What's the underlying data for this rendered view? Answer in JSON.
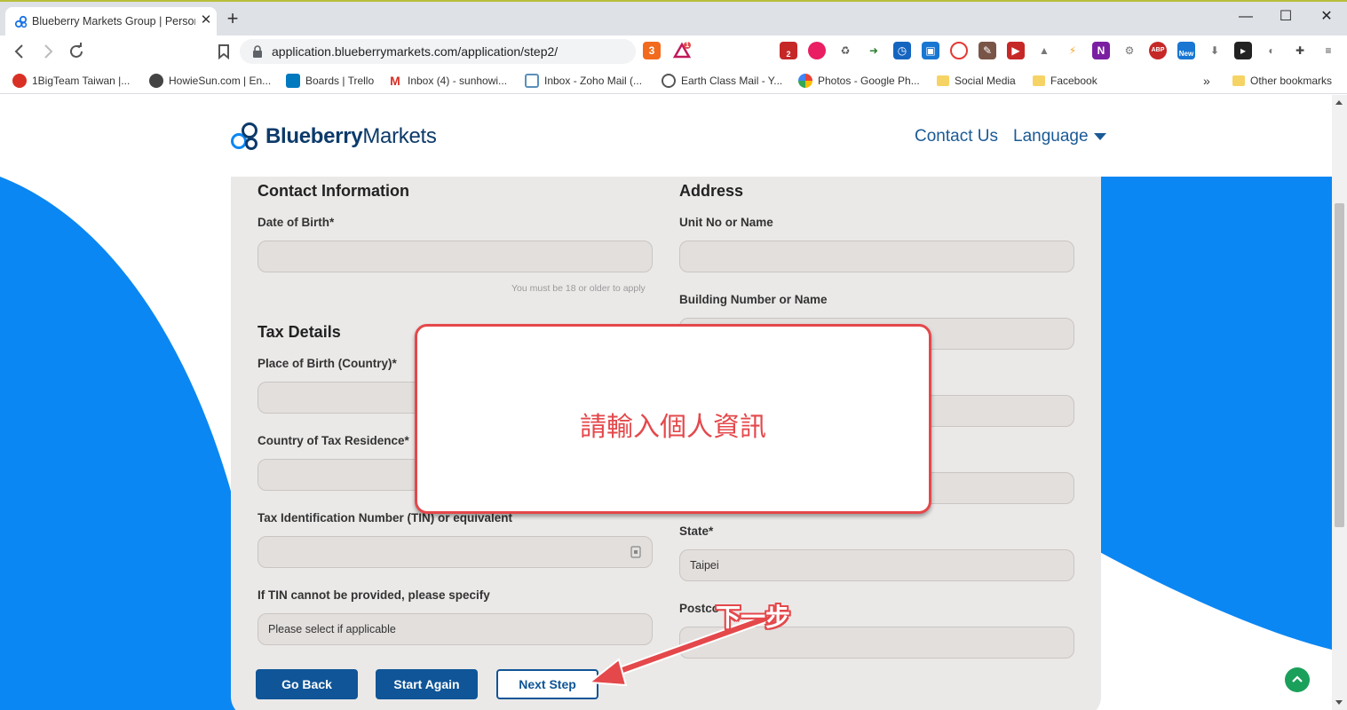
{
  "browser": {
    "tab_title": "Blueberry Markets Group | Persona",
    "tab_close": "✕",
    "new_tab": "+",
    "window_controls": {
      "minimize": "—",
      "maximize": "☐",
      "close": "✕"
    },
    "url": "application.blueberrymarkets.com/application/step2/",
    "extension_badges": {
      "brave": "3",
      "alert": "1",
      "mail": "2",
      "new": "New",
      "abp": "ABP"
    }
  },
  "bookmarks": [
    {
      "label": "1BigTeam Taiwan |...",
      "icon": "1bigteam-icon",
      "color": "#d93025"
    },
    {
      "label": "HowieSun.com | En...",
      "icon": "howiesun-icon",
      "color": "#444444"
    },
    {
      "label": "Boards | Trello",
      "icon": "trello-icon",
      "color": "#0079bf"
    },
    {
      "label": "Inbox (4) - sunhowi...",
      "icon": "gmail-icon",
      "color": "#d93025"
    },
    {
      "label": "Inbox - Zoho Mail (...",
      "icon": "zoho-icon",
      "color": "#5b8fb9"
    },
    {
      "label": "Earth Class Mail - Y...",
      "icon": "earthclass-icon",
      "color": "#555555"
    },
    {
      "label": "Photos - Google Ph...",
      "icon": "google-photos-icon",
      "color": "#fbbc04"
    },
    {
      "label": "Social Media",
      "icon": "folder-icon",
      "color": "#f6d365"
    },
    {
      "label": "Facebook",
      "icon": "folder-icon",
      "color": "#f6d365"
    }
  ],
  "bookmarks_more": "»",
  "other_bookmarks": "Other bookmarks",
  "site": {
    "logo_bold": "Blueberry",
    "logo_light": "Markets",
    "nav_contact": "Contact Us",
    "nav_language": "Language",
    "brand_color": "#0a87f3"
  },
  "form": {
    "contact_title": "Contact Information",
    "dob_label": "Date of Birth*",
    "dob_hint": "You must be 18 or older to apply",
    "tax_title": "Tax Details",
    "pob_label": "Place of Birth (Country)*",
    "residence_label": "Country of Tax Residence*",
    "tin_label": "Tax Identification Number (TIN) or equivalent",
    "tin_missing_label": "If TIN cannot be provided, please specify",
    "tin_missing_placeholder": "Please select if applicable",
    "address_title": "Address",
    "unit_label": "Unit No or Name",
    "building_label": "Building Number or Name",
    "state_label": "State*",
    "state_value": "Taipei",
    "postcode_label": "Postco"
  },
  "buttons": {
    "go_back": "Go Back",
    "start_again": "Start Again",
    "next_step": "Next Step"
  },
  "annotations": {
    "popup_text": "請輸入個人資訊",
    "arrow_text": "下一步",
    "color": "#e4484b"
  }
}
